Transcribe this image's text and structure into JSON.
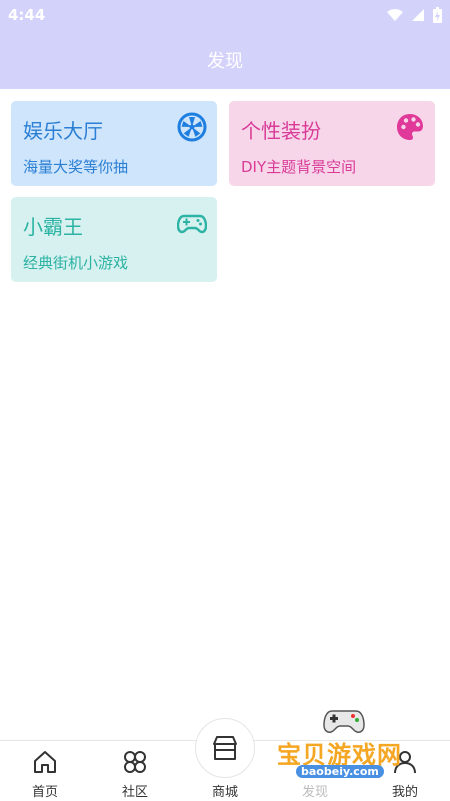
{
  "status": {
    "time": "4:44"
  },
  "header": {
    "title": "发现"
  },
  "cards": [
    {
      "title": "娱乐大厅",
      "subtitle": "海量大奖等你抽",
      "icon": "wheel-icon",
      "color": "#2a7fd4"
    },
    {
      "title": "个性装扮",
      "subtitle": "DIY主题背景空间",
      "icon": "palette-icon",
      "color": "#d93b97"
    },
    {
      "title": "小霸王",
      "subtitle": "经典街机小游戏",
      "icon": "gamepad-icon",
      "color": "#2cb3a3"
    }
  ],
  "tabbar": {
    "items": [
      {
        "label": "首页",
        "icon": "home-icon"
      },
      {
        "label": "社区",
        "icon": "community-icon"
      },
      {
        "label": "商城",
        "icon": "shop-icon"
      },
      {
        "label": "发现",
        "icon": "discover-icon"
      },
      {
        "label": "我的",
        "icon": "profile-icon"
      }
    ]
  },
  "watermark": {
    "text": "宝贝游戏网",
    "url": "baobeiy.com"
  }
}
